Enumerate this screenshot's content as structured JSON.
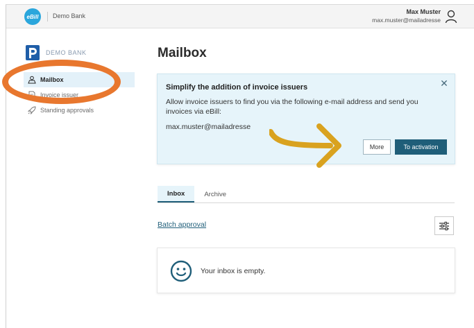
{
  "header": {
    "logo_text": "eBill",
    "bank_name": "Demo Bank",
    "user_name": "Max Muster",
    "user_email": "max.muster@mailadresse"
  },
  "sidebar": {
    "brand_text": "DEMO BANK",
    "items": [
      {
        "label": "Mailbox",
        "icon": "mailbox-icon",
        "active": true
      },
      {
        "label": "Invoice issuer",
        "icon": "document-icon",
        "active": false
      },
      {
        "label": "Standing approvals",
        "icon": "rocket-icon",
        "active": false
      }
    ]
  },
  "main": {
    "title": "Mailbox",
    "banner": {
      "title": "Simplify the addition of invoice issuers",
      "text": "Allow invoice issuers to find you via the following e-mail address and send you invoices via eBill:",
      "email": "max.muster@mailadresse",
      "more_label": "More",
      "activate_label": "To activation"
    },
    "tabs": [
      {
        "label": "Inbox",
        "active": true
      },
      {
        "label": "Archive",
        "active": false
      }
    ],
    "batch_approval_label": "Batch approval",
    "empty_message": "Your inbox is empty."
  },
  "colors": {
    "accent": "#1f5e79",
    "brand_blue": "#2aa6dc",
    "highlight_orange": "#e8772e",
    "arrow_gold": "#d9a21f",
    "banner_bg": "#e6f4fa"
  }
}
